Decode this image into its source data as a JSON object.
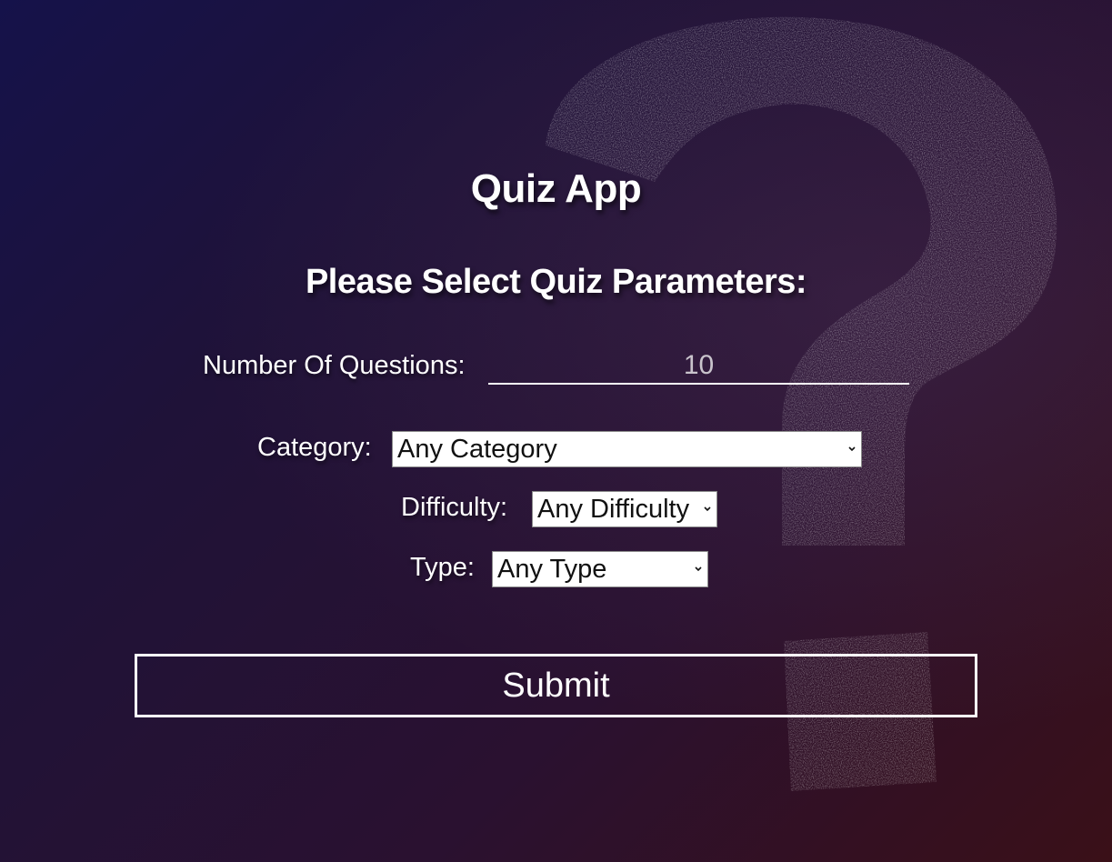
{
  "app": {
    "title": "Quiz App",
    "subtitle": "Please Select Quiz Parameters:"
  },
  "form": {
    "questions": {
      "label": "Number Of Questions:",
      "value": "10"
    },
    "category": {
      "label": "Category:",
      "selected": "Any Category"
    },
    "difficulty": {
      "label": "Difficulty:",
      "selected": "Any Difficulty"
    },
    "type": {
      "label": "Type:",
      "selected": "Any Type"
    },
    "submit_label": "Submit"
  },
  "icons": {
    "background": "question-mark-chalk-icon",
    "dropdown": "chevron-down-icon"
  },
  "colors": {
    "text": "#ffffff",
    "bg_start": "#15124a",
    "bg_end": "#3a1018"
  }
}
